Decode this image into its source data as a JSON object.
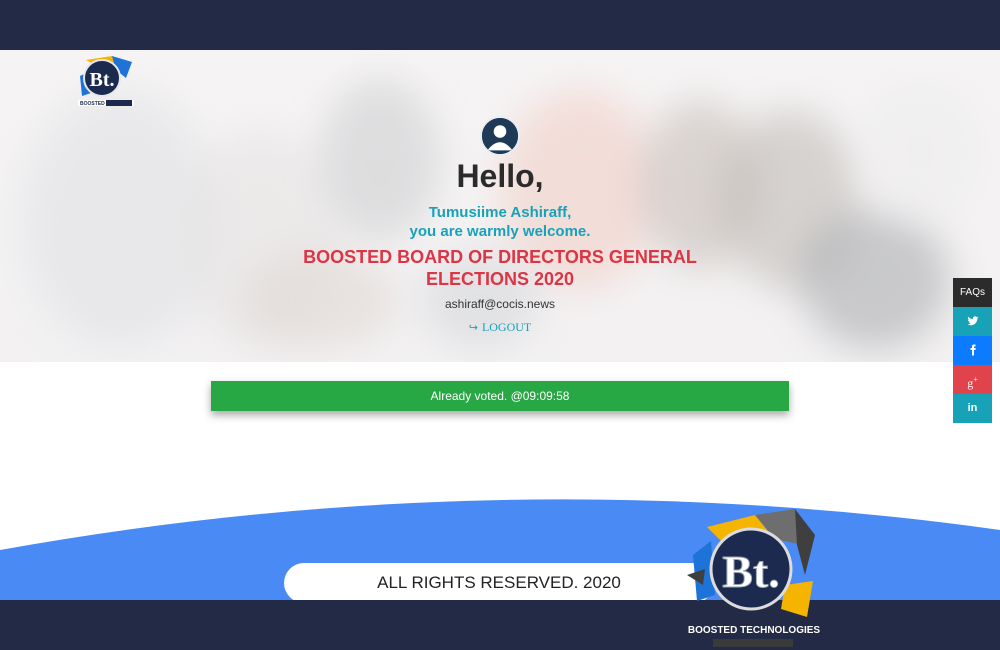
{
  "brand": {
    "small_logo_text": "BOOSTED",
    "big_logo_mark": "Bt.",
    "big_logo_text": "BOOSTED TECHNOLOGIES"
  },
  "hero": {
    "greeting": "Hello,",
    "user_name_line": "Tumusiime Ashiraff,",
    "welcome_line": "you are warmly welcome.",
    "election_line1": "BOOSTED BOARD OF DIRECTORS GENERAL",
    "election_line2": "ELECTIONS 2020",
    "email": "ashiraff@cocis.news",
    "logout_label": "LOGOUT"
  },
  "status": {
    "message": "Already voted. @09:09:58"
  },
  "footer": {
    "rights": "ALL RIGHTS RESERVED. 2020"
  },
  "sidebar": {
    "faq_label": "FAQs",
    "icons": [
      "twitter-icon",
      "facebook-icon",
      "google-plus-icon",
      "linkedin-icon"
    ]
  },
  "colors": {
    "dark_band": "#222a45",
    "accent_teal": "#17a2b8",
    "accent_red": "#dc3545",
    "success_green": "#28a745",
    "wave_blue": "#4a8af4"
  }
}
